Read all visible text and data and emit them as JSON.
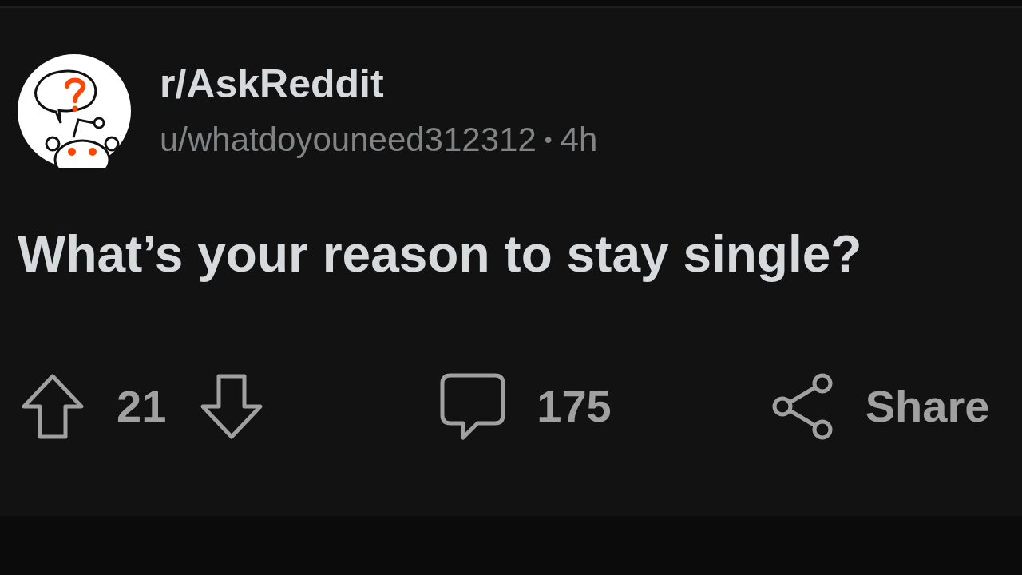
{
  "post": {
    "subreddit": "r/AskReddit",
    "author": "u/whatdoyouneed312312",
    "separator": "•",
    "age": "4h",
    "title": "What’s your reason to stay single?",
    "votes": "21",
    "comments": "175",
    "share": "Share"
  }
}
